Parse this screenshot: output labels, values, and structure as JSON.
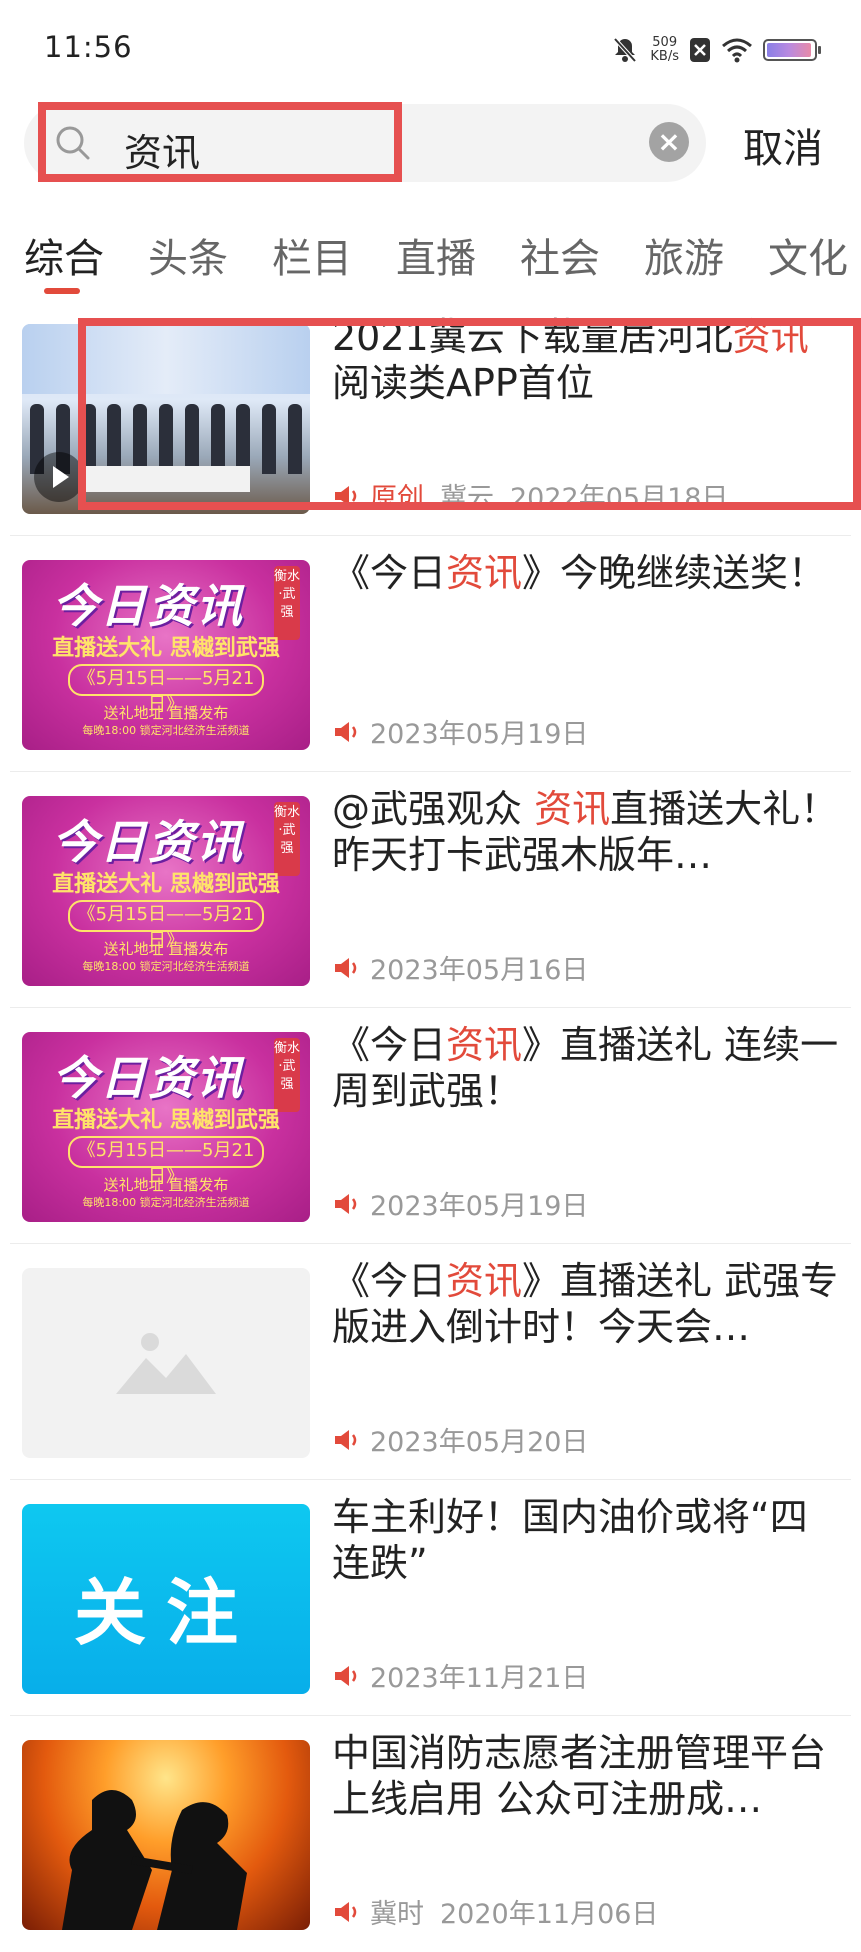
{
  "status_bar": {
    "time": "11:56",
    "net_speed_value": "509",
    "net_speed_unit": "KB/s"
  },
  "search": {
    "query": "资讯",
    "cancel_label": "取消"
  },
  "tabs": [
    {
      "label": "综合",
      "active": true
    },
    {
      "label": "头条"
    },
    {
      "label": "栏目"
    },
    {
      "label": "直播"
    },
    {
      "label": "社会"
    },
    {
      "label": "旅游"
    },
    {
      "label": "文化"
    }
  ],
  "thumbs": {
    "today_news": {
      "logo": "今日资讯",
      "side_tag": "衡水·武强",
      "subtitle": "直播送大礼 思樾到武强",
      "dates": "《5月15日——5月21日》",
      "line1": "送礼地址 直播发布",
      "line2": "每晚18:00 锁定河北经济生活频道"
    },
    "follow": "关注"
  },
  "news": [
    {
      "title_pre": "2021冀云下载量居河北",
      "title_hl": "资讯",
      "title_post": "阅读类APP首位",
      "tag": "原创",
      "source": "冀云",
      "date": "2022年05月18日"
    },
    {
      "title_pre": "《今日",
      "title_hl": "资讯",
      "title_post": "》今晚继续送奖！",
      "date": "2023年05月19日"
    },
    {
      "title_pre": "@武强观众 ",
      "title_hl": "资讯",
      "title_post": "直播送大礼！昨天打卡武强木版年…",
      "date": "2023年05月16日"
    },
    {
      "title_pre": "《今日",
      "title_hl": "资讯",
      "title_post": "》直播送礼 连续一周到武强！",
      "date": "2023年05月19日"
    },
    {
      "title_pre": "《今日",
      "title_hl": "资讯",
      "title_post": "》直播送礼 武强专版进入倒计时！今天会…",
      "date": "2023年05月20日"
    },
    {
      "title_pre": "车主利好！国内油价或将“四连跌”",
      "title_hl": "",
      "title_post": "",
      "date": "2023年11月21日"
    },
    {
      "title_pre": "中国消防志愿者注册管理平台上线启用 公众可注册成…",
      "title_hl": "",
      "title_post": "",
      "source": "冀时",
      "date": "2020年11月06日"
    }
  ]
}
